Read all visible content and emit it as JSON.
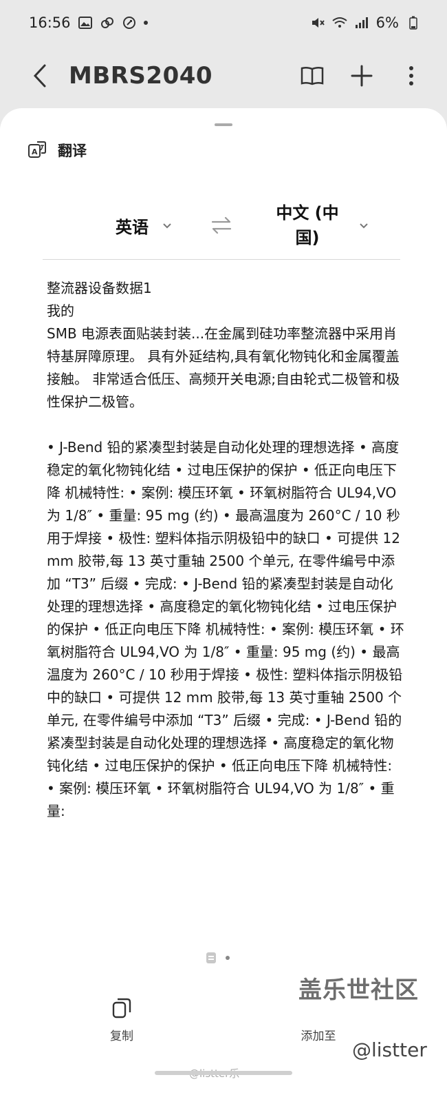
{
  "status_bar": {
    "time": "16:56",
    "battery": "6%",
    "left_icons": [
      "gallery-icon",
      "link-icon",
      "music-icon"
    ],
    "right_icons": [
      "mute-icon",
      "wifi-icon",
      "signal-icon",
      "battery-icon"
    ]
  },
  "app_bar": {
    "title": "MBRS2040",
    "actions": [
      "book-icon",
      "plus-icon",
      "more-vert-icon"
    ]
  },
  "sheet": {
    "title": "翻译",
    "source_language": "英语",
    "target_language": "中文 (中国)",
    "translation_text": "整流器设备数据1\n我的\nSMB 电源表面贴装封装...在金属到硅功率整流器中采用肖特基屏障原理。 具有外延结构,具有氧化物钝化和金属覆盖接触。 非常适合低压、高频开关电源;自由轮式二极管和极性保护二极管。\n\n• J-Bend 铅的紧凑型封装是自动化处理的理想选择 • 高度稳定的氧化物钝化结 • 过电压保护的保护 • 低正向电压下降 机械特性: • 案例: 模压环氧 • 环氧树脂符合 UL94,VO 为 1/8″ • 重量: 95 mg (约) • 最高温度为 260°C / 10 秒用于焊接 • 极性: 塑料体指示阴极铅中的缺口 • 可提供 12 mm 胶带,每 13 英寸重轴 2500 个单元, 在零件编号中添加 “T3” 后缀 • 完成: • J-Bend 铅的紧凑型封装是自动化处理的理想选择 • 高度稳定的氧化物钝化结 • 过电压保护的保护 • 低正向电压下降 机械特性: • 案例: 模压环氧 • 环氧树脂符合 UL94,VO 为 1/8″ • 重量: 95 mg (约) • 最高温度为 260°C / 10 秒用于焊接 • 极性: 塑料体指示阴极铅中的缺口 • 可提供 12 mm 胶带,每 13 英寸重轴 2500 个单元, 在零件编号中添加 “T3” 后缀 • 完成: • J-Bend 铅的紧凑型封装是自动化处理的理想选择 • 高度稳定的氧化物钝化结 • 过电压保护的保护 • 低正向电压下降 机械特性: • 案例: 模压环氧 • 环氧树脂符合 UL94,VO 为 1/8″ • 重量:"
  },
  "bottom_bar": {
    "copy_label": "复制",
    "add_label": "添加至"
  },
  "watermark": {
    "brand": "盖乐世社区",
    "handle": "@listter",
    "weibo": "@listter乐"
  }
}
